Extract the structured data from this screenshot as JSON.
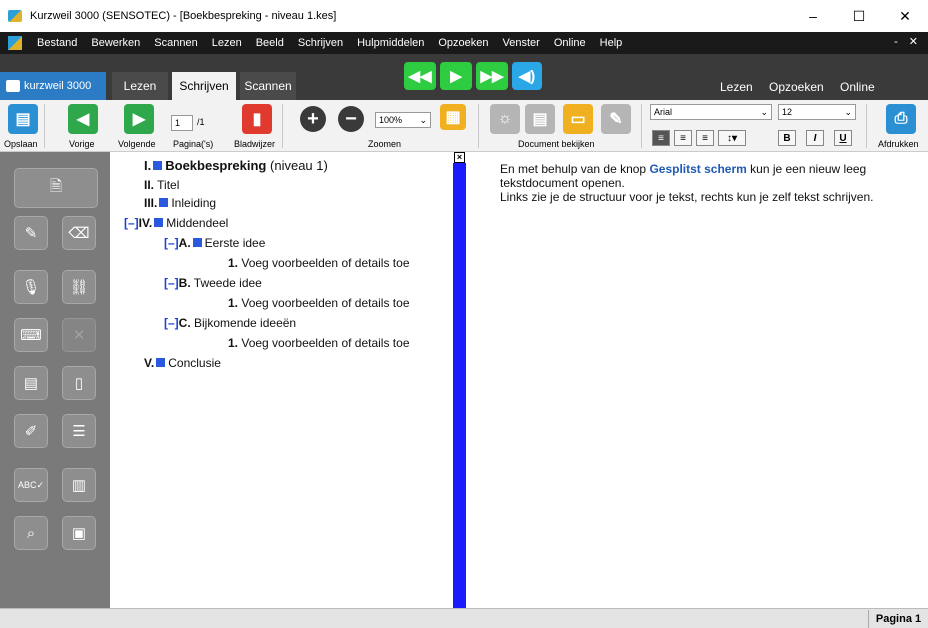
{
  "window": {
    "title": "Kurzweil 3000 (SENSOTEC) - [Boekbespreking - niveau 1.kes]",
    "minimize": "–",
    "maximize": "☐",
    "close": "✕"
  },
  "menu": {
    "items": [
      "Bestand",
      "Bewerken",
      "Scannen",
      "Lezen",
      "Beeld",
      "Schrijven",
      "Hulpmiddelen",
      "Opzoeken",
      "Venster",
      "Online",
      "Help"
    ],
    "right": "- ✕"
  },
  "tabs": {
    "brand": "kurzweil 3000",
    "items": [
      "Lezen",
      "Schrijven",
      "Scannen"
    ],
    "active": "Schrijven",
    "right_links": [
      "Lezen",
      "Opzoeken",
      "Online"
    ]
  },
  "toolbar": {
    "save": "Opslaan",
    "prev": "Vorige",
    "next": "Volgende",
    "page_value": "1",
    "page_total": "/1",
    "pages": "Pagina('s)",
    "bookmark": "Bladwijzer",
    "zoom_value": "100%",
    "zoom": "Zoomen",
    "doc_view": "Document bekijken",
    "font": "Arial",
    "size": "12",
    "bold": "B",
    "italic": "I",
    "underline": "U",
    "print": "Afdrukken"
  },
  "outline": {
    "items": [
      {
        "num": "I.",
        "text": "Boekbespreking",
        "extra": "(niveau 1)"
      },
      {
        "num": "II.",
        "text": "Titel"
      },
      {
        "num": "III.",
        "text": "Inleiding"
      },
      {
        "prefix": "[–]",
        "num": "IV.",
        "text": "Middendeel"
      },
      {
        "prefix": "[–]",
        "num": "A.",
        "text": "Eerste idee"
      },
      {
        "num": "1.",
        "text": "Voeg voorbeelden of details toe"
      },
      {
        "prefix": "[–]",
        "num": "B.",
        "text": "Tweede idee"
      },
      {
        "num": "1.",
        "text": "Voeg voorbeelden of details toe"
      },
      {
        "prefix": "[–]",
        "num": "C.",
        "text": "Bijkomende ideeën"
      },
      {
        "num": "1.",
        "text": "Voeg voorbeelden of details toe"
      },
      {
        "num": "V.",
        "text": "Conclusie"
      }
    ],
    "close": "×"
  },
  "editor": {
    "line1_pre": "En met behulp van de knop ",
    "line1_hl": "Gesplitst scherm",
    "line1_post": " kun je een nieuw leeg",
    "line2": "tekstdocument openen.",
    "line3": "Links zie je de structuur voor je tekst, rechts kun je zelf tekst schrijven."
  },
  "status": {
    "page": "Pagina 1"
  }
}
